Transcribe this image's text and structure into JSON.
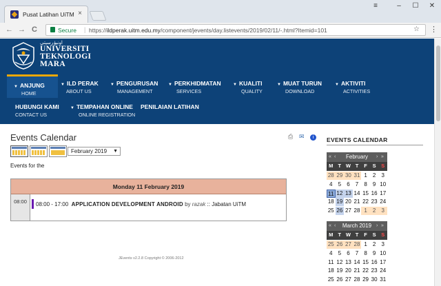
{
  "browser": {
    "tab_title": "Pusat Latihan UiTM",
    "tab_close": "×",
    "secure_label": "Secure",
    "url_prefix": "https://",
    "url_domain": "ildperak.uitm.edu.my",
    "url_path": "/component/jevents/day.listevents/2019/02/11/-.html?Itemid=101",
    "back": "←",
    "forward": "→",
    "reload": "C",
    "star": "☆",
    "menu": "⋮",
    "win_min": "–",
    "win_max": "☐",
    "win_close": "✕",
    "win_user": "≡"
  },
  "header": {
    "logo_jawi": "اونيۏرسيتي",
    "logo_line1": "UNIVERSITI",
    "logo_line2": "TEKNOLOGI",
    "logo_line3": "MARA"
  },
  "nav": {
    "row1": [
      {
        "main": "ANJUNG",
        "sub": "HOME",
        "active": true
      },
      {
        "main": "ILD PERAK",
        "sub": "ABOUT US",
        "active": false
      },
      {
        "main": "PENGURUSAN",
        "sub": "MANAGEMENT",
        "active": false
      },
      {
        "main": "PERKHIDMATAN",
        "sub": "SERVICES",
        "active": false
      },
      {
        "main": "KUALITI",
        "sub": "QUALITY",
        "active": false
      },
      {
        "main": "MUAT TURUN",
        "sub": "DOWNLOAD",
        "active": false
      },
      {
        "main": "AKTIVITI",
        "sub": "ACTIVITIES",
        "active": false
      }
    ],
    "row2": [
      {
        "main": "HUBUNGI KAMI",
        "sub": "CONTACT US",
        "caret": false
      },
      {
        "main": "TEMPAHAN ONLINE",
        "sub": "ONLINE REGISTRATION",
        "caret": true
      },
      {
        "main": "PENILAIAN LATIHAN",
        "sub": "",
        "caret": false
      }
    ]
  },
  "content": {
    "title": "Events Calendar",
    "month_select": "February 2019",
    "events_for": "Events for the",
    "day_heading": "Monday 11 February 2019",
    "hour": "08:00",
    "event_time": "08:00 - 17:00",
    "event_title": "APPLICATION DEVELOPMENT ANDROID",
    "event_by": "by",
    "event_author": "razak",
    "event_sep": "::",
    "event_org": "Jabatan UiTM",
    "footer": "JEvents v2.2.8     Copyright © 2006-2012"
  },
  "sidebar": {
    "title": "EVENTS CALENDAR",
    "dow": [
      "M",
      "T",
      "W",
      "T",
      "F",
      "S",
      "S"
    ],
    "calendars": [
      {
        "month": "February 2019",
        "weeks": [
          [
            [
              "28",
              "prev"
            ],
            [
              "29",
              "prev"
            ],
            [
              "30",
              "prev"
            ],
            [
              "31",
              "prev"
            ],
            [
              "1",
              "cur"
            ],
            [
              "2",
              "cur"
            ],
            [
              "3",
              "cur"
            ]
          ],
          [
            [
              "4",
              "cur"
            ],
            [
              "5",
              "cur"
            ],
            [
              "6",
              "cur"
            ],
            [
              "7",
              "cur"
            ],
            [
              "8",
              "cur"
            ],
            [
              "9",
              "cur"
            ],
            [
              "10",
              "cur"
            ]
          ],
          [
            [
              "11",
              "today"
            ],
            [
              "12",
              "ev"
            ],
            [
              "13",
              "ev"
            ],
            [
              "14",
              "cur"
            ],
            [
              "15",
              "cur"
            ],
            [
              "16",
              "cur"
            ],
            [
              "17",
              "cur"
            ]
          ],
          [
            [
              "18",
              "cur"
            ],
            [
              "19",
              "ev"
            ],
            [
              "20",
              "cur"
            ],
            [
              "21",
              "cur"
            ],
            [
              "22",
              "cur"
            ],
            [
              "23",
              "cur"
            ],
            [
              "24",
              "cur"
            ]
          ],
          [
            [
              "25",
              "cur"
            ],
            [
              "26",
              "ev"
            ],
            [
              "27",
              "cur"
            ],
            [
              "28",
              "cur"
            ],
            [
              "1",
              "next"
            ],
            [
              "2",
              "next"
            ],
            [
              "3",
              "next"
            ]
          ]
        ]
      },
      {
        "month": "March 2019",
        "weeks": [
          [
            [
              "25",
              "prev"
            ],
            [
              "26",
              "prev"
            ],
            [
              "27",
              "prev"
            ],
            [
              "28",
              "prev"
            ],
            [
              "1",
              "cur"
            ],
            [
              "2",
              "cur"
            ],
            [
              "3",
              "cur"
            ]
          ],
          [
            [
              "4",
              "cur"
            ],
            [
              "5",
              "cur"
            ],
            [
              "6",
              "cur"
            ],
            [
              "7",
              "cur"
            ],
            [
              "8",
              "cur"
            ],
            [
              "9",
              "cur"
            ],
            [
              "10",
              "cur"
            ]
          ],
          [
            [
              "11",
              "cur"
            ],
            [
              "12",
              "cur"
            ],
            [
              "13",
              "cur"
            ],
            [
              "14",
              "cur"
            ],
            [
              "15",
              "cur"
            ],
            [
              "16",
              "cur"
            ],
            [
              "17",
              "cur"
            ]
          ],
          [
            [
              "18",
              "cur"
            ],
            [
              "19",
              "cur"
            ],
            [
              "20",
              "cur"
            ],
            [
              "21",
              "cur"
            ],
            [
              "22",
              "cur"
            ],
            [
              "23",
              "cur"
            ],
            [
              "24",
              "cur"
            ]
          ],
          [
            [
              "25",
              "cur"
            ],
            [
              "26",
              "cur"
            ],
            [
              "27",
              "cur"
            ],
            [
              "28",
              "cur"
            ],
            [
              "29",
              "cur"
            ],
            [
              "30",
              "cur"
            ],
            [
              "31",
              "cur"
            ]
          ]
        ]
      }
    ],
    "nav_prev2": "«",
    "nav_prev": "‹",
    "nav_next": "›",
    "nav_next2": "»"
  }
}
